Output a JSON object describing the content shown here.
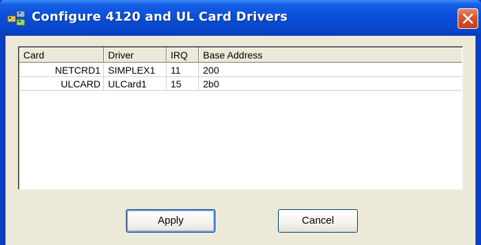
{
  "window": {
    "title": "Configure 4120 and UL Card Drivers",
    "title_icon": "network-cards-icon",
    "close_icon": "close-icon"
  },
  "list": {
    "columns": [
      "Card",
      "Driver",
      "IRQ",
      "Base Address"
    ],
    "rows": [
      {
        "card": "NETCRD1",
        "driver": "SIMPLEX1",
        "irq": "11",
        "base_address": "200"
      },
      {
        "card": "ULCARD",
        "driver": "ULCard1",
        "irq": "15",
        "base_address": "2b0"
      }
    ]
  },
  "buttons": {
    "apply": "Apply",
    "cancel": "Cancel"
  },
  "colors": {
    "titlebar": "#0A4FD8",
    "close": "#D4522F",
    "dialog_bg": "#ECE9D8"
  }
}
